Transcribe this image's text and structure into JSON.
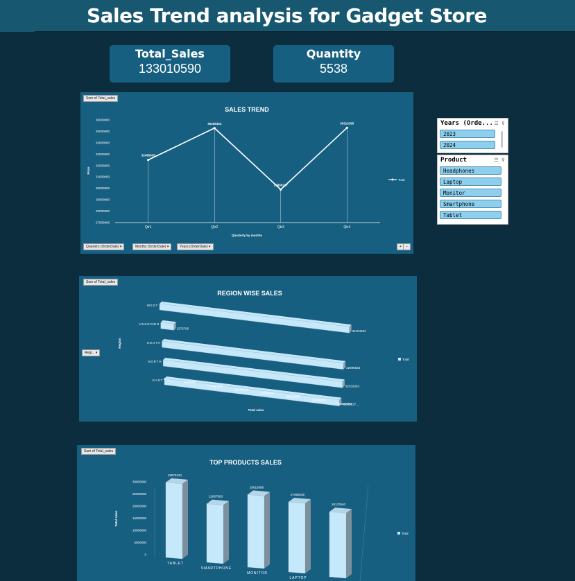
{
  "page": {
    "title": "Sales Trend analysis for Gadget Store"
  },
  "kpis": [
    {
      "label": "Total_Sales",
      "value": "133010590"
    },
    {
      "label": "Quantity",
      "value": "5538"
    }
  ],
  "trend_panel": {
    "field_button": "Sum of Total_sales",
    "filters": [
      "Quarters (OrderDate)",
      "Months (OrderDate)",
      "Years (OrderDate)"
    ],
    "legend": "Total",
    "expand_buttons": [
      "+",
      "−"
    ]
  },
  "region_panel": {
    "field_button": "Sum of Total_sales",
    "filter": "Regi...",
    "legend": "Total"
  },
  "products_panel": {
    "field_button": "Sum of Total_sales",
    "legend": "Total"
  },
  "slicers": {
    "years": {
      "header": "Years (Orde...",
      "items": [
        "2023",
        "2024"
      ]
    },
    "product": {
      "header": "Product",
      "items": [
        "Headphones",
        "Laptop",
        "Monitor",
        "Smartphone",
        "Tablet"
      ]
    }
  },
  "colors": {
    "background": "#0b2d3d",
    "panel": "#175f80",
    "bar": "#c6e8fb",
    "accent": "#8ecfee"
  },
  "chart_data": [
    {
      "type": "line",
      "title": "SALES TREND",
      "xlabel": "Quarterly by months",
      "ylabel": "Price",
      "categories": [
        "Qtr1",
        "Qtr2",
        "Qtr3",
        "Qtr4"
      ],
      "series": [
        {
          "name": "Total",
          "values": [
            32495635,
            35285354,
            29895217,
            35313385
          ]
        }
      ],
      "data_labels": [
        "32495635",
        "35285354",
        "29895217",
        "35313385"
      ],
      "yticks": [
        "36000000",
        "35000000",
        "34000000",
        "33000000",
        "32000000",
        "31000000",
        "30000000",
        "29000000",
        "28000000",
        "27000000"
      ],
      "ylim": [
        27000000,
        36000000
      ],
      "legend": "right"
    },
    {
      "type": "bar",
      "orientation": "horizontal",
      "title": "REGION WISE SALES",
      "xlabel": "Total sales",
      "ylabel": "Region",
      "categories": [
        "WEST",
        "UNKNOWN",
        "SOUTH",
        "NORTH",
        "EAST"
      ],
      "series": [
        {
          "name": "Total",
          "values": [
            34204632,
            2375765,
            32696633,
            32333333,
            31536227
          ]
        }
      ],
      "data_labels": [
        "34204632",
        "2375765",
        "32696633",
        "32333333",
        "31536227..."
      ],
      "xticks": [
        "0",
        "5000000",
        "10000000",
        "15000000",
        "20000000",
        "25000000",
        "30000000",
        "35000000"
      ],
      "xlim": [
        0,
        35000000
      ],
      "legend": "right"
    },
    {
      "type": "bar",
      "title": "TOP PRODUCTS SALES",
      "ylabel": "Total sales",
      "categories": [
        "TABLET",
        "SMARTPHONE",
        "MONITOR",
        "LAPTOP",
        ""
      ],
      "series": [
        {
          "name": "Total",
          "values": [
            28976334,
            22607583,
            28019398,
            27069035,
            25137640
          ]
        }
      ],
      "data_labels": [
        "28976334",
        "22607583",
        "28019398",
        "27069035",
        "25137640"
      ],
      "yticks": [
        "30000000",
        "25000000",
        "20000000",
        "15000000",
        "10000000",
        "5000000",
        "0"
      ],
      "ylim": [
        0,
        30000000
      ],
      "legend": "right"
    }
  ]
}
